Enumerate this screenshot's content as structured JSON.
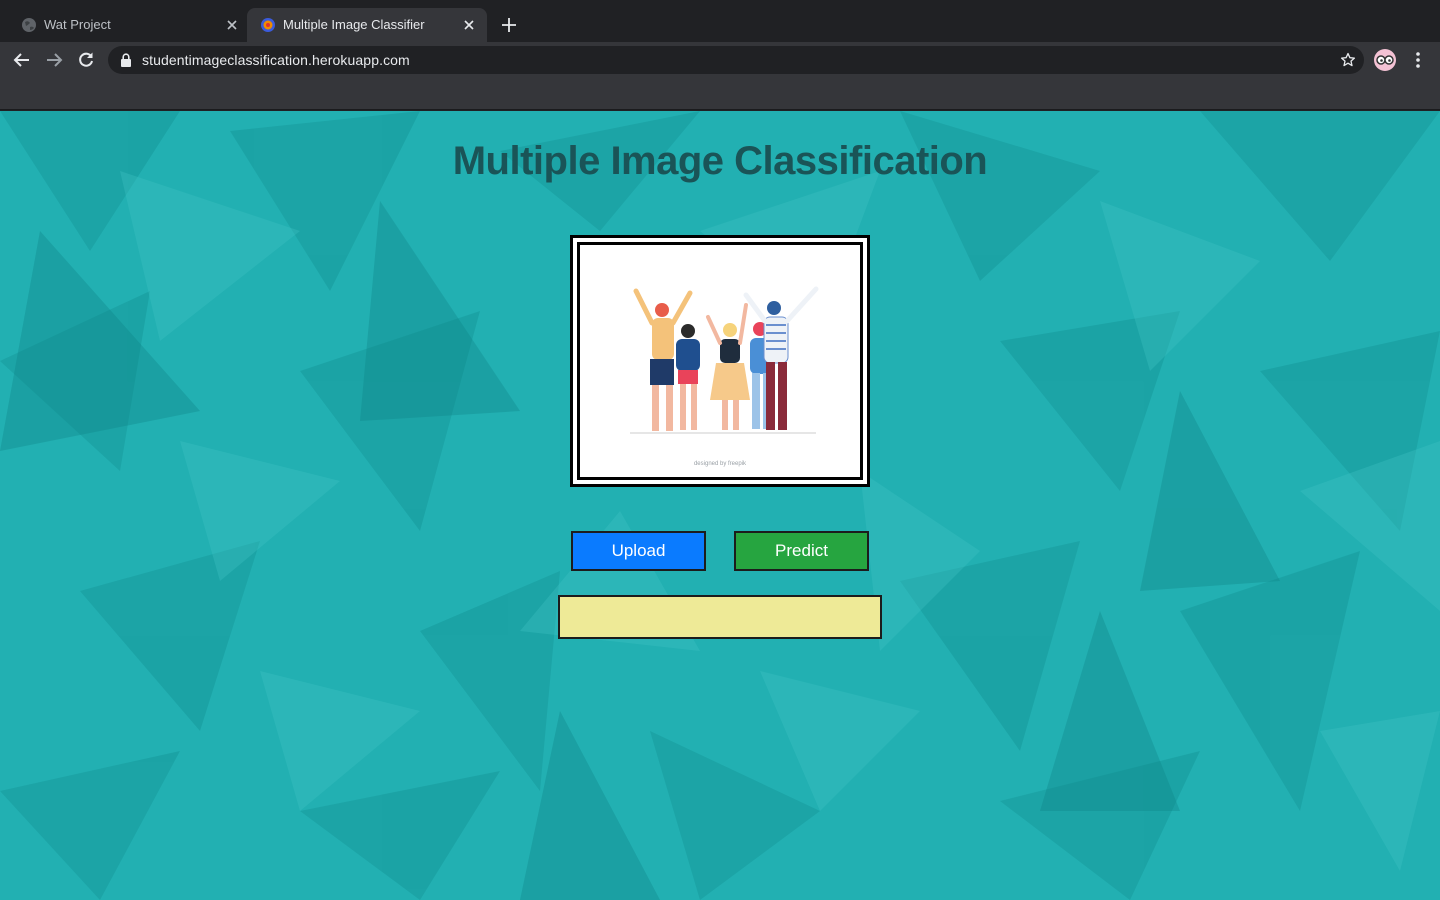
{
  "browser": {
    "tabs": [
      {
        "title": "Wat Project",
        "active": false
      },
      {
        "title": "Multiple Image Classifier",
        "active": true
      }
    ],
    "url": "studentimageclassification.herokuapp.com"
  },
  "page": {
    "title": "Multiple Image Classification",
    "image_credit": "designed by freepik",
    "upload_label": "Upload",
    "predict_label": "Predict",
    "result_text": ""
  },
  "colors": {
    "page_background": "#22b0b2",
    "title": "#1a5457",
    "upload_button": "#0a7bff",
    "predict_button": "#26a540",
    "result_box": "#eeea97"
  }
}
